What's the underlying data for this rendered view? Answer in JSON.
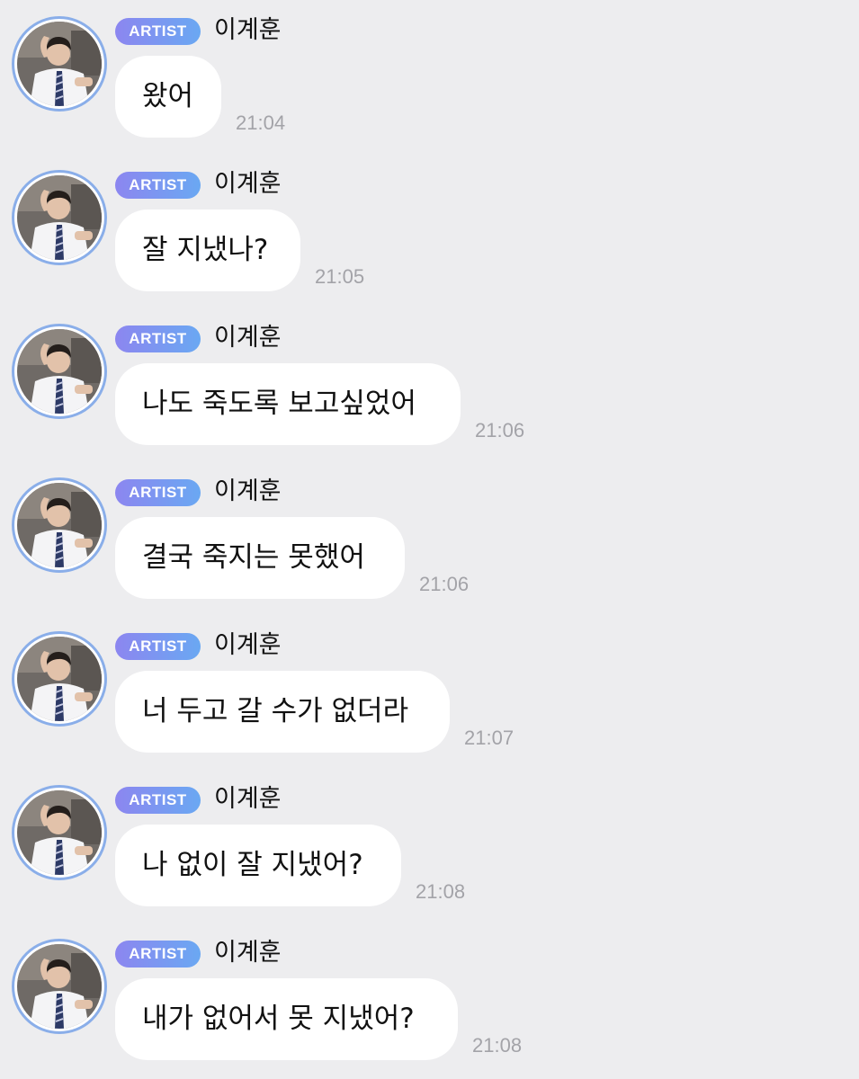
{
  "messages": [
    {
      "badge": "ARTIST",
      "sender": "이계훈",
      "text": "왔어",
      "time": "21:04"
    },
    {
      "badge": "ARTIST",
      "sender": "이계훈",
      "text": "잘 지냈나?",
      "time": "21:05"
    },
    {
      "badge": "ARTIST",
      "sender": "이계훈",
      "text": "나도 죽도록 보고싶었어",
      "time": "21:06"
    },
    {
      "badge": "ARTIST",
      "sender": "이계훈",
      "text": "결국 죽지는 못했어",
      "time": "21:06"
    },
    {
      "badge": "ARTIST",
      "sender": "이계훈",
      "text": "너 두고 갈 수가 없더라",
      "time": "21:07"
    },
    {
      "badge": "ARTIST",
      "sender": "이계훈",
      "text": "나 없이 잘 지냈어?",
      "time": "21:08"
    },
    {
      "badge": "ARTIST",
      "sender": "이계훈",
      "text": "내가 없어서 못 지냈어?",
      "time": "21:08"
    }
  ],
  "colors": {
    "background": "#ededef",
    "bubble": "#ffffff",
    "badge_start": "#8c86f0",
    "badge_end": "#6aa8f2",
    "avatar_ring": "#8aaee9",
    "timestamp": "#a3a3a8"
  },
  "icons": {
    "avatar": "artist-profile-photo"
  }
}
